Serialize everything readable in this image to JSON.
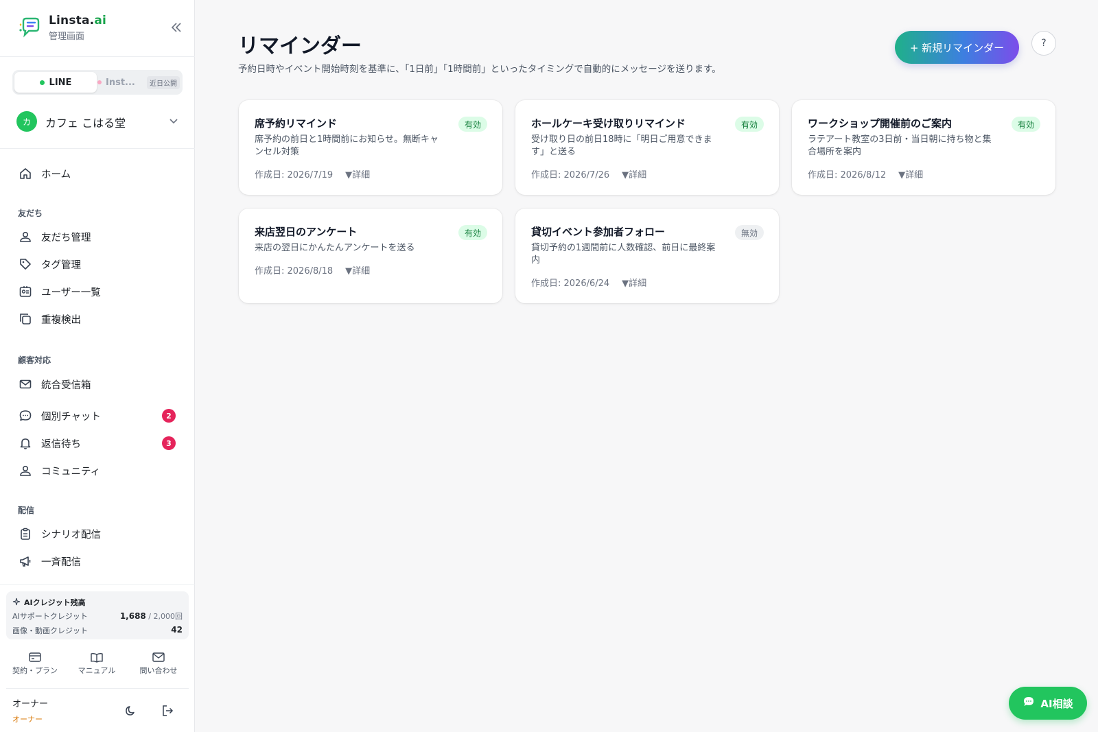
{
  "brand": {
    "name_main": "Linsta.",
    "name_ai": "ai",
    "subtitle": "管理画面"
  },
  "platform": {
    "line_label": "LINE",
    "inst_label": "Inst...",
    "soon_label": "近日公開"
  },
  "account": {
    "avatar_letter": "カ",
    "name": "カフェ こはる堂"
  },
  "nav": {
    "home": "ホーム",
    "sections": {
      "friends": "友だち",
      "support": "顧客対応",
      "delivery": "配信"
    },
    "friends_items": [
      "友だち管理",
      "タグ管理",
      "ユーザー一覧",
      "重複検出"
    ],
    "support_items": [
      {
        "label": "統合受信箱",
        "badge": ""
      },
      {
        "label": "個別チャット",
        "badge": "2"
      },
      {
        "label": "返信待ち",
        "badge": "3"
      },
      {
        "label": "コミュニティ",
        "badge": ""
      }
    ],
    "delivery_items": [
      "シナリオ配信",
      "一斉配信"
    ]
  },
  "credits": {
    "title": "AIクレジット残高",
    "support_label": "AIサポートクレジット",
    "support_used": "1,688",
    "support_total": " / 2,000回",
    "media_label": "画像・動画クレジット",
    "media_value": "42"
  },
  "bottom_links": [
    "契約・プラン",
    "マニュアル",
    "問い合わせ"
  ],
  "user": {
    "name": "オーナー",
    "role": "オーナー"
  },
  "page": {
    "title": "リマインダー",
    "description": "予約日時やイベント開始時刻を基準に、「1日前」「1時間前」といったタイミングで自動的にメッセージを送ります。",
    "new_button": "+ 新規リマインダー",
    "help_button": "?"
  },
  "reminders": [
    {
      "title": "席予約リマインド",
      "status": "有効",
      "description": "席予約の前日と1時間前にお知らせ。無断キャンセル対策",
      "created": "作成日: 2026/7/19",
      "detail": "▼詳細"
    },
    {
      "title": "ホールケーキ受け取りリマインド",
      "status": "有効",
      "description": "受け取り日の前日18時に「明日ご用意できます」と送る",
      "created": "作成日: 2026/7/26",
      "detail": "▼詳細"
    },
    {
      "title": "ワークショップ開催前のご案内",
      "status": "有効",
      "description": "ラテアート教室の3日前・当日朝に持ち物と集合場所を案内",
      "created": "作成日: 2026/8/12",
      "detail": "▼詳細"
    },
    {
      "title": "来店翌日のアンケート",
      "status": "有効",
      "description": "来店の翌日にかんたんアンケートを送る",
      "created": "作成日: 2026/8/18",
      "detail": "▼詳細"
    },
    {
      "title": "貸切イベント参加者フォロー",
      "status": "無効",
      "description": "貸切予約の1週間前に人数確認、前日に最終案内",
      "created": "作成日: 2026/6/24",
      "detail": "▼詳細"
    }
  ],
  "ai_button": "AI相談",
  "colors": {
    "accent": "#22c55e",
    "badge_red": "#e5245b",
    "status_on": "#15803d",
    "status_off": "#6b7280"
  }
}
